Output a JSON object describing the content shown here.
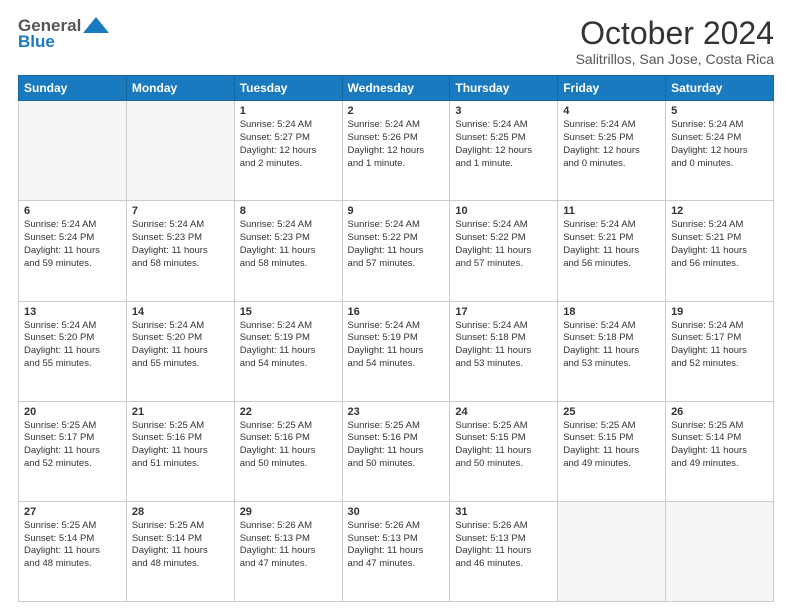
{
  "header": {
    "logo_line1": "General",
    "logo_line2": "Blue",
    "month": "October 2024",
    "location": "Salitrillos, San Jose, Costa Rica"
  },
  "weekdays": [
    "Sunday",
    "Monday",
    "Tuesday",
    "Wednesday",
    "Thursday",
    "Friday",
    "Saturday"
  ],
  "weeks": [
    [
      {
        "day": "",
        "info": ""
      },
      {
        "day": "",
        "info": ""
      },
      {
        "day": "1",
        "info": "Sunrise: 5:24 AM\nSunset: 5:27 PM\nDaylight: 12 hours\nand 2 minutes."
      },
      {
        "day": "2",
        "info": "Sunrise: 5:24 AM\nSunset: 5:26 PM\nDaylight: 12 hours\nand 1 minute."
      },
      {
        "day": "3",
        "info": "Sunrise: 5:24 AM\nSunset: 5:25 PM\nDaylight: 12 hours\nand 1 minute."
      },
      {
        "day": "4",
        "info": "Sunrise: 5:24 AM\nSunset: 5:25 PM\nDaylight: 12 hours\nand 0 minutes."
      },
      {
        "day": "5",
        "info": "Sunrise: 5:24 AM\nSunset: 5:24 PM\nDaylight: 12 hours\nand 0 minutes."
      }
    ],
    [
      {
        "day": "6",
        "info": "Sunrise: 5:24 AM\nSunset: 5:24 PM\nDaylight: 11 hours\nand 59 minutes."
      },
      {
        "day": "7",
        "info": "Sunrise: 5:24 AM\nSunset: 5:23 PM\nDaylight: 11 hours\nand 58 minutes."
      },
      {
        "day": "8",
        "info": "Sunrise: 5:24 AM\nSunset: 5:23 PM\nDaylight: 11 hours\nand 58 minutes."
      },
      {
        "day": "9",
        "info": "Sunrise: 5:24 AM\nSunset: 5:22 PM\nDaylight: 11 hours\nand 57 minutes."
      },
      {
        "day": "10",
        "info": "Sunrise: 5:24 AM\nSunset: 5:22 PM\nDaylight: 11 hours\nand 57 minutes."
      },
      {
        "day": "11",
        "info": "Sunrise: 5:24 AM\nSunset: 5:21 PM\nDaylight: 11 hours\nand 56 minutes."
      },
      {
        "day": "12",
        "info": "Sunrise: 5:24 AM\nSunset: 5:21 PM\nDaylight: 11 hours\nand 56 minutes."
      }
    ],
    [
      {
        "day": "13",
        "info": "Sunrise: 5:24 AM\nSunset: 5:20 PM\nDaylight: 11 hours\nand 55 minutes."
      },
      {
        "day": "14",
        "info": "Sunrise: 5:24 AM\nSunset: 5:20 PM\nDaylight: 11 hours\nand 55 minutes."
      },
      {
        "day": "15",
        "info": "Sunrise: 5:24 AM\nSunset: 5:19 PM\nDaylight: 11 hours\nand 54 minutes."
      },
      {
        "day": "16",
        "info": "Sunrise: 5:24 AM\nSunset: 5:19 PM\nDaylight: 11 hours\nand 54 minutes."
      },
      {
        "day": "17",
        "info": "Sunrise: 5:24 AM\nSunset: 5:18 PM\nDaylight: 11 hours\nand 53 minutes."
      },
      {
        "day": "18",
        "info": "Sunrise: 5:24 AM\nSunset: 5:18 PM\nDaylight: 11 hours\nand 53 minutes."
      },
      {
        "day": "19",
        "info": "Sunrise: 5:24 AM\nSunset: 5:17 PM\nDaylight: 11 hours\nand 52 minutes."
      }
    ],
    [
      {
        "day": "20",
        "info": "Sunrise: 5:25 AM\nSunset: 5:17 PM\nDaylight: 11 hours\nand 52 minutes."
      },
      {
        "day": "21",
        "info": "Sunrise: 5:25 AM\nSunset: 5:16 PM\nDaylight: 11 hours\nand 51 minutes."
      },
      {
        "day": "22",
        "info": "Sunrise: 5:25 AM\nSunset: 5:16 PM\nDaylight: 11 hours\nand 50 minutes."
      },
      {
        "day": "23",
        "info": "Sunrise: 5:25 AM\nSunset: 5:16 PM\nDaylight: 11 hours\nand 50 minutes."
      },
      {
        "day": "24",
        "info": "Sunrise: 5:25 AM\nSunset: 5:15 PM\nDaylight: 11 hours\nand 50 minutes."
      },
      {
        "day": "25",
        "info": "Sunrise: 5:25 AM\nSunset: 5:15 PM\nDaylight: 11 hours\nand 49 minutes."
      },
      {
        "day": "26",
        "info": "Sunrise: 5:25 AM\nSunset: 5:14 PM\nDaylight: 11 hours\nand 49 minutes."
      }
    ],
    [
      {
        "day": "27",
        "info": "Sunrise: 5:25 AM\nSunset: 5:14 PM\nDaylight: 11 hours\nand 48 minutes."
      },
      {
        "day": "28",
        "info": "Sunrise: 5:25 AM\nSunset: 5:14 PM\nDaylight: 11 hours\nand 48 minutes."
      },
      {
        "day": "29",
        "info": "Sunrise: 5:26 AM\nSunset: 5:13 PM\nDaylight: 11 hours\nand 47 minutes."
      },
      {
        "day": "30",
        "info": "Sunrise: 5:26 AM\nSunset: 5:13 PM\nDaylight: 11 hours\nand 47 minutes."
      },
      {
        "day": "31",
        "info": "Sunrise: 5:26 AM\nSunset: 5:13 PM\nDaylight: 11 hours\nand 46 minutes."
      },
      {
        "day": "",
        "info": ""
      },
      {
        "day": "",
        "info": ""
      }
    ]
  ]
}
